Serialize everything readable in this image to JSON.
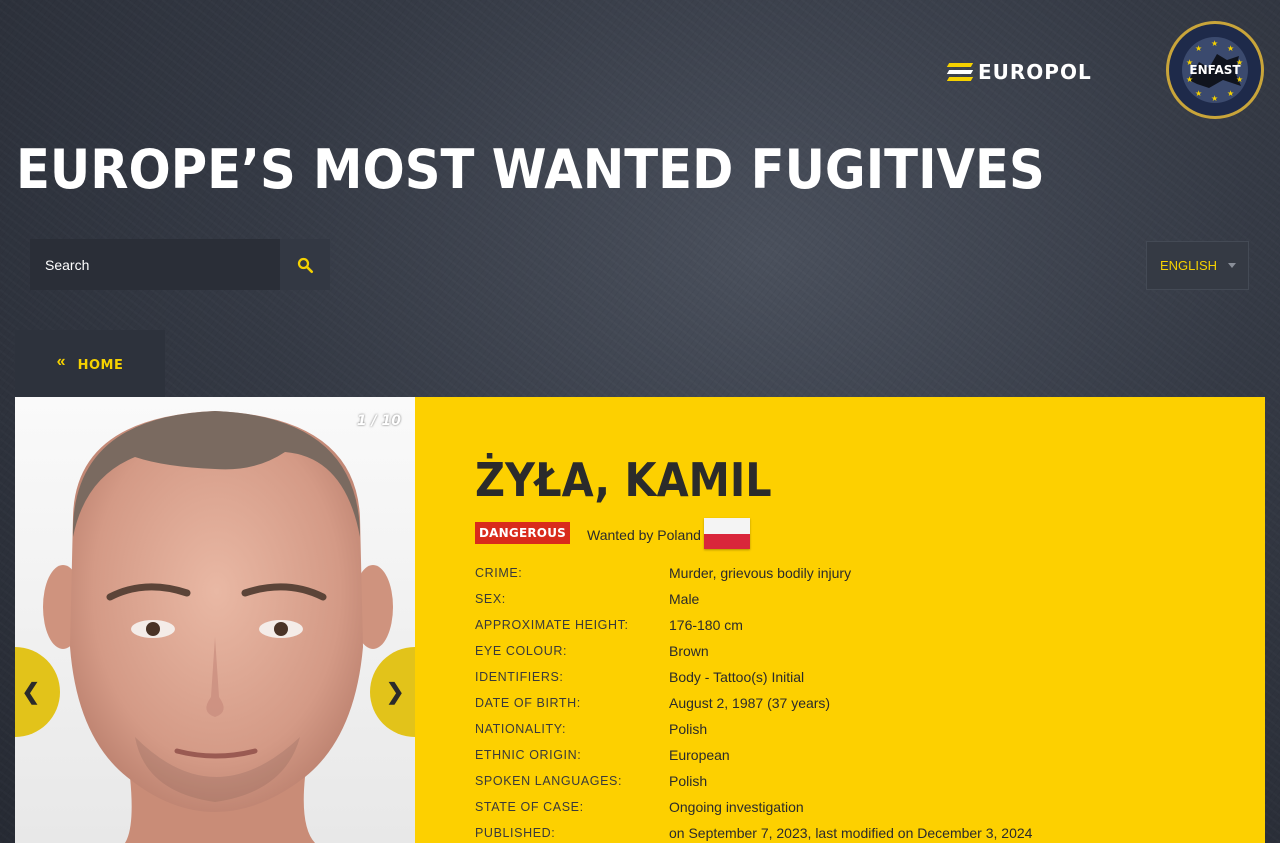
{
  "header": {
    "europol_logo_text": "EUROPOL",
    "enfast_logo_text": "ENFAST",
    "title": "EUROPE’S MOST WANTED FUGITIVES"
  },
  "search": {
    "placeholder": "Search",
    "icon": "search-icon"
  },
  "language": {
    "selected": "ENGLISH"
  },
  "nav": {
    "home_label": "HOME",
    "home_icon": "double-chevron-left-icon"
  },
  "photo": {
    "counter": "1 / 10",
    "prev_label": "❮",
    "next_label": "❯"
  },
  "fugitive": {
    "name": "ŻYŁA, KAMIL",
    "badge": "DANGEROUS",
    "wanted_by": "Wanted by Poland",
    "flag": "poland-flag",
    "details": [
      {
        "label": "CRIME:",
        "value": "Murder, grievous bodily injury"
      },
      {
        "label": "SEX:",
        "value": "Male"
      },
      {
        "label": "APPROXIMATE HEIGHT:",
        "value": "176-180 cm"
      },
      {
        "label": "EYE COLOUR:",
        "value": "Brown"
      },
      {
        "label": "IDENTIFIERS:",
        "value": "Body - Tattoo(s) Initial"
      },
      {
        "label": "DATE OF BIRTH:",
        "value": "August 2, 1987 (37 years)"
      },
      {
        "label": "NATIONALITY:",
        "value": "Polish"
      },
      {
        "label": "ETHNIC ORIGIN:",
        "value": "European"
      },
      {
        "label": "SPOKEN LANGUAGES:",
        "value": "Polish"
      },
      {
        "label": "STATE OF CASE:",
        "value": "Ongoing investigation"
      },
      {
        "label": "PUBLISHED:",
        "value": "on September 7, 2023, last modified on December 3, 2024"
      }
    ]
  },
  "colors": {
    "accent_yellow": "#fdd000",
    "danger_red": "#d92b1c",
    "background_dark": "#353a45"
  }
}
